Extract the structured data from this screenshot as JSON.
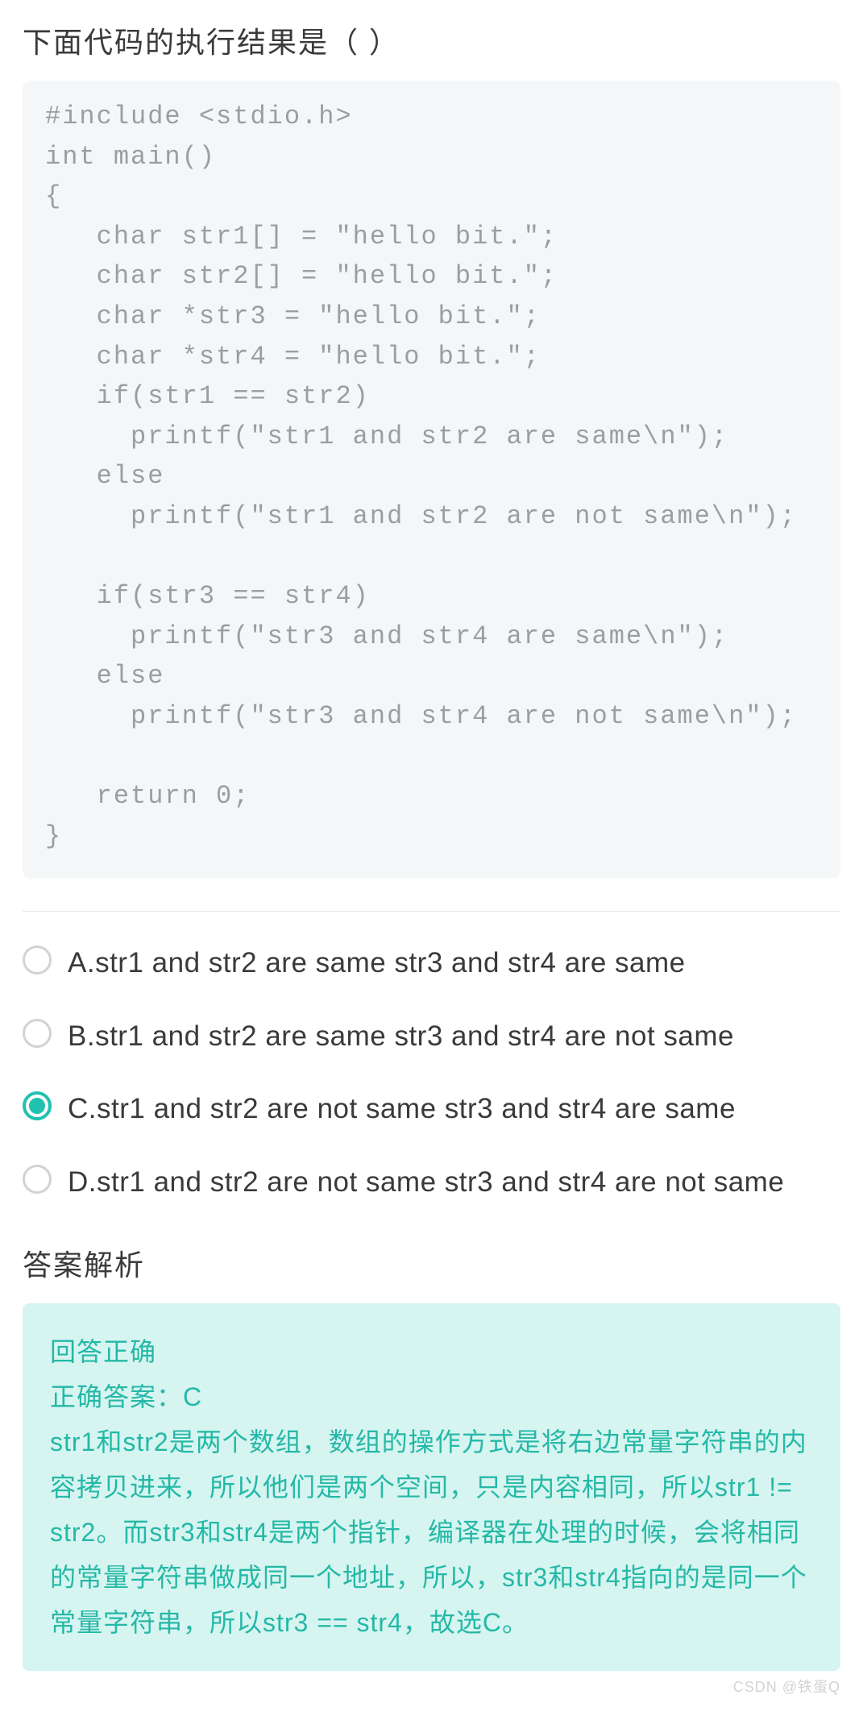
{
  "question_title": "下面代码的执行结果是（ ）",
  "code": "#include <stdio.h>\nint main()\n{\n   char str1[] = \"hello bit.\";\n   char str2[] = \"hello bit.\";\n   char *str3 = \"hello bit.\";\n   char *str4 = \"hello bit.\";\n   if(str1 == str2)\n     printf(\"str1 and str2 are same\\n\");\n   else\n     printf(\"str1 and str2 are not same\\n\");\n\n   if(str3 == str4)\n     printf(\"str3 and str4 are same\\n\");\n   else\n     printf(\"str3 and str4 are not same\\n\");\n\n   return 0;\n}",
  "options": [
    {
      "letter": "A",
      "text": "A.str1 and str2 are same str3 and str4 are same",
      "selected": false
    },
    {
      "letter": "B",
      "text": "B.str1 and str2 are same str3 and str4 are not same",
      "selected": false
    },
    {
      "letter": "C",
      "text": "C.str1 and str2 are not same str3 and str4 are same",
      "selected": true
    },
    {
      "letter": "D",
      "text": "D.str1 and str2 are not same str3 and str4 are not same",
      "selected": false
    }
  ],
  "explanation_heading": "答案解析",
  "explanation": {
    "status": "回答正确",
    "correct": "正确答案：C",
    "body": "str1和str2是两个数组，数组的操作方式是将右边常量字符串的内容拷贝进来，所以他们是两个空间，只是内容相同，所以str1 != str2。而str3和str4是两个指针，编译器在处理的时候，会将相同的常量字符串做成同一个地址，所以，str3和str4指向的是同一个常量字符串，所以str3 == str4，故选C。"
  },
  "attribution": "CSDN @铁蛋Q"
}
